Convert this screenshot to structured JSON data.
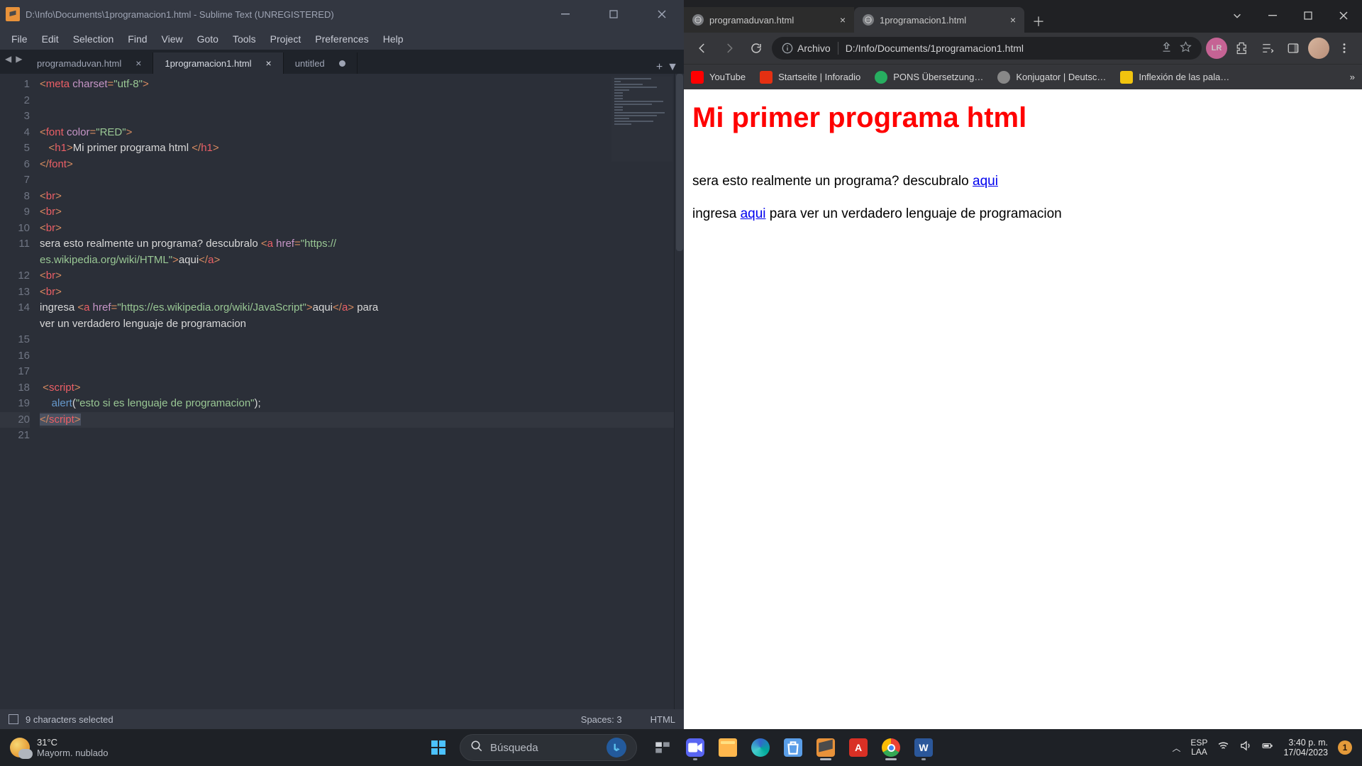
{
  "sublime": {
    "title": "D:\\Info\\Documents\\1programacion1.html - Sublime Text (UNREGISTERED)",
    "menu": [
      "File",
      "Edit",
      "Selection",
      "Find",
      "View",
      "Goto",
      "Tools",
      "Project",
      "Preferences",
      "Help"
    ],
    "tabs": [
      {
        "label": "programaduvan.html",
        "active": false,
        "close": true
      },
      {
        "label": "1programacion1.html",
        "active": true,
        "close": true
      },
      {
        "label": "untitled",
        "active": false,
        "dirty": true
      }
    ],
    "lines": [
      {
        "n": "1",
        "seg": [
          {
            "t": "<",
            "c": "c-p"
          },
          {
            "t": "meta",
            "c": "c-t"
          },
          {
            "t": " ",
            "c": "c-d"
          },
          {
            "t": "charset",
            "c": "c-a"
          },
          {
            "t": "=",
            "c": "c-p"
          },
          {
            "t": "\"utf-8\"",
            "c": "c-s"
          },
          {
            "t": ">",
            "c": "c-p"
          }
        ]
      },
      {
        "n": "2",
        "seg": []
      },
      {
        "n": "3",
        "seg": []
      },
      {
        "n": "4",
        "seg": [
          {
            "t": "<",
            "c": "c-p"
          },
          {
            "t": "font",
            "c": "c-t"
          },
          {
            "t": " ",
            "c": "c-d"
          },
          {
            "t": "color",
            "c": "c-a"
          },
          {
            "t": "=",
            "c": "c-p"
          },
          {
            "t": "\"RED\"",
            "c": "c-s"
          },
          {
            "t": ">",
            "c": "c-p"
          }
        ]
      },
      {
        "n": "5",
        "seg": [
          {
            "t": "   ",
            "c": "c-d"
          },
          {
            "t": "<",
            "c": "c-p"
          },
          {
            "t": "h1",
            "c": "c-t"
          },
          {
            "t": ">",
            "c": "c-p"
          },
          {
            "t": "Mi primer programa html ",
            "c": "c-d"
          },
          {
            "t": "</",
            "c": "c-p"
          },
          {
            "t": "h1",
            "c": "c-t"
          },
          {
            "t": ">",
            "c": "c-p"
          }
        ]
      },
      {
        "n": "6",
        "seg": [
          {
            "t": "</",
            "c": "c-p"
          },
          {
            "t": "font",
            "c": "c-t"
          },
          {
            "t": ">",
            "c": "c-p"
          }
        ]
      },
      {
        "n": "7",
        "seg": []
      },
      {
        "n": "8",
        "seg": [
          {
            "t": "<",
            "c": "c-p"
          },
          {
            "t": "br",
            "c": "c-t"
          },
          {
            "t": ">",
            "c": "c-p"
          }
        ]
      },
      {
        "n": "9",
        "seg": [
          {
            "t": "<",
            "c": "c-p"
          },
          {
            "t": "br",
            "c": "c-t"
          },
          {
            "t": ">",
            "c": "c-p"
          }
        ]
      },
      {
        "n": "10",
        "seg": [
          {
            "t": "<",
            "c": "c-p"
          },
          {
            "t": "br",
            "c": "c-t"
          },
          {
            "t": ">",
            "c": "c-p"
          }
        ]
      },
      {
        "n": "11",
        "seg": [
          {
            "t": "sera esto realmente un programa? descubralo ",
            "c": "c-d"
          },
          {
            "t": "<",
            "c": "c-p"
          },
          {
            "t": "a",
            "c": "c-t"
          },
          {
            "t": " ",
            "c": "c-d"
          },
          {
            "t": "href",
            "c": "c-a"
          },
          {
            "t": "=",
            "c": "c-p"
          },
          {
            "t": "\"https://",
            "c": "c-s"
          }
        ]
      },
      {
        "n": "",
        "seg": [
          {
            "t": "es.wikipedia.org/wiki/HTML\"",
            "c": "c-s"
          },
          {
            "t": ">",
            "c": "c-p"
          },
          {
            "t": "aqui",
            "c": "c-d"
          },
          {
            "t": "</",
            "c": "c-p"
          },
          {
            "t": "a",
            "c": "c-t"
          },
          {
            "t": ">",
            "c": "c-p"
          }
        ]
      },
      {
        "n": "12",
        "seg": [
          {
            "t": "<",
            "c": "c-p"
          },
          {
            "t": "br",
            "c": "c-t"
          },
          {
            "t": ">",
            "c": "c-p"
          }
        ]
      },
      {
        "n": "13",
        "seg": [
          {
            "t": "<",
            "c": "c-p"
          },
          {
            "t": "br",
            "c": "c-t"
          },
          {
            "t": ">",
            "c": "c-p"
          }
        ]
      },
      {
        "n": "14",
        "seg": [
          {
            "t": "ingresa ",
            "c": "c-d"
          },
          {
            "t": "<",
            "c": "c-p"
          },
          {
            "t": "a",
            "c": "c-t"
          },
          {
            "t": " ",
            "c": "c-d"
          },
          {
            "t": "href",
            "c": "c-a"
          },
          {
            "t": "=",
            "c": "c-p"
          },
          {
            "t": "\"https://es.wikipedia.org/wiki/JavaScript\"",
            "c": "c-s"
          },
          {
            "t": ">",
            "c": "c-p"
          },
          {
            "t": "aqui",
            "c": "c-d"
          },
          {
            "t": "</",
            "c": "c-p"
          },
          {
            "t": "a",
            "c": "c-t"
          },
          {
            "t": ">",
            "c": "c-p"
          },
          {
            "t": " para ",
            "c": "c-d"
          }
        ]
      },
      {
        "n": "",
        "seg": [
          {
            "t": "ver un verdadero lenguaje de programacion",
            "c": "c-d"
          }
        ]
      },
      {
        "n": "15",
        "seg": []
      },
      {
        "n": "16",
        "seg": []
      },
      {
        "n": "17",
        "seg": []
      },
      {
        "n": "18",
        "seg": [
          {
            "t": " ",
            "c": "c-d"
          },
          {
            "t": "<",
            "c": "c-p"
          },
          {
            "t": "script",
            "c": "c-t"
          },
          {
            "t": ">",
            "c": "c-p"
          }
        ]
      },
      {
        "n": "19",
        "seg": [
          {
            "t": "    ",
            "c": "c-d"
          },
          {
            "t": "alert",
            "c": "c-f"
          },
          {
            "t": "(",
            "c": "c-d"
          },
          {
            "t": "\"esto si es lenguaje de programacion\"",
            "c": "c-s"
          },
          {
            "t": ");",
            "c": "c-d"
          }
        ]
      },
      {
        "n": "20",
        "sel": true,
        "seg": [
          {
            "t": "</",
            "c": "c-p"
          },
          {
            "t": "script",
            "c": "c-t"
          },
          {
            "t": ">",
            "c": "c-p"
          }
        ]
      },
      {
        "n": "21",
        "seg": []
      }
    ],
    "status": {
      "sel": "9 characters selected",
      "spaces": "Spaces: 3",
      "syntax": "HTML"
    }
  },
  "chrome": {
    "tabs": [
      {
        "label": "programaduvan.html",
        "active": false
      },
      {
        "label": "1programacion1.html",
        "active": true
      }
    ],
    "url_label": "Archivo",
    "url_path": "D:/Info/Documents/1programacion1.html",
    "bookmarks": [
      {
        "label": "YouTube",
        "cls": "yt"
      },
      {
        "label": "Startseite | Inforadio",
        "cls": "rbb"
      },
      {
        "label": "PONS Übersetzung…",
        "cls": "pons"
      },
      {
        "label": "Konjugator | Deutsc…",
        "cls": "kon"
      },
      {
        "label": "Inflexión de las pala…",
        "cls": "inf"
      }
    ],
    "page": {
      "h1": "Mi primer programa html",
      "p1a": "sera esto realmente un programa? descubralo ",
      "p1link": "aqui",
      "p2a": "ingresa ",
      "p2link": "aqui",
      "p2b": " para ver un verdadero lenguaje de programacion"
    }
  },
  "taskbar": {
    "temp": "31°C",
    "cond": "Mayorm. nublado",
    "search": "Búsqueda",
    "lang1": "ESP",
    "lang2": "LAA",
    "time": "3:40 p. m.",
    "date": "17/04/2023",
    "notif": "1"
  }
}
